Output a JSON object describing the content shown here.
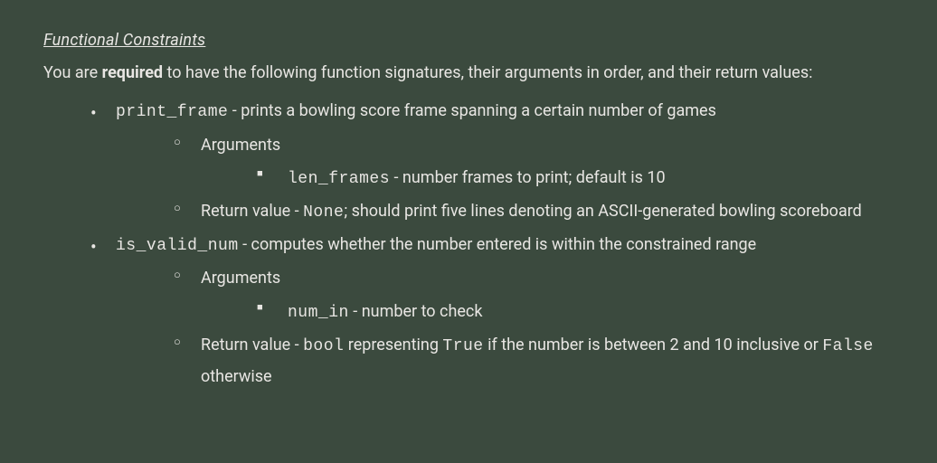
{
  "heading": "Functional Constraints",
  "intro_pre": "You are ",
  "intro_bold": "required",
  "intro_post": " to have the following function signatures, their arguments in order, and their return values:",
  "func1": {
    "name": "print_frame",
    "desc": " - prints a bowling score frame spanning a certain number of games",
    "args_label": "Arguments",
    "arg1_name": "len_frames",
    "arg1_desc": " - number frames to print; default is 10",
    "return_pre": "Return value - ",
    "return_code": "None",
    "return_post": "; should print five lines denoting an ASCII-generated bowling scoreboard"
  },
  "func2": {
    "name": "is_valid_num",
    "desc": " - computes whether the number entered is within the constrained range",
    "args_label": "Arguments",
    "arg1_name": "num_in",
    "arg1_desc": " - number to check",
    "return_pre": "Return value - ",
    "return_code1": "bool",
    "return_mid1": " representing ",
    "return_code2": "True",
    "return_mid2": " if the number is between 2 and 10 inclusive or ",
    "return_code3": "False",
    "return_post": " otherwise"
  }
}
